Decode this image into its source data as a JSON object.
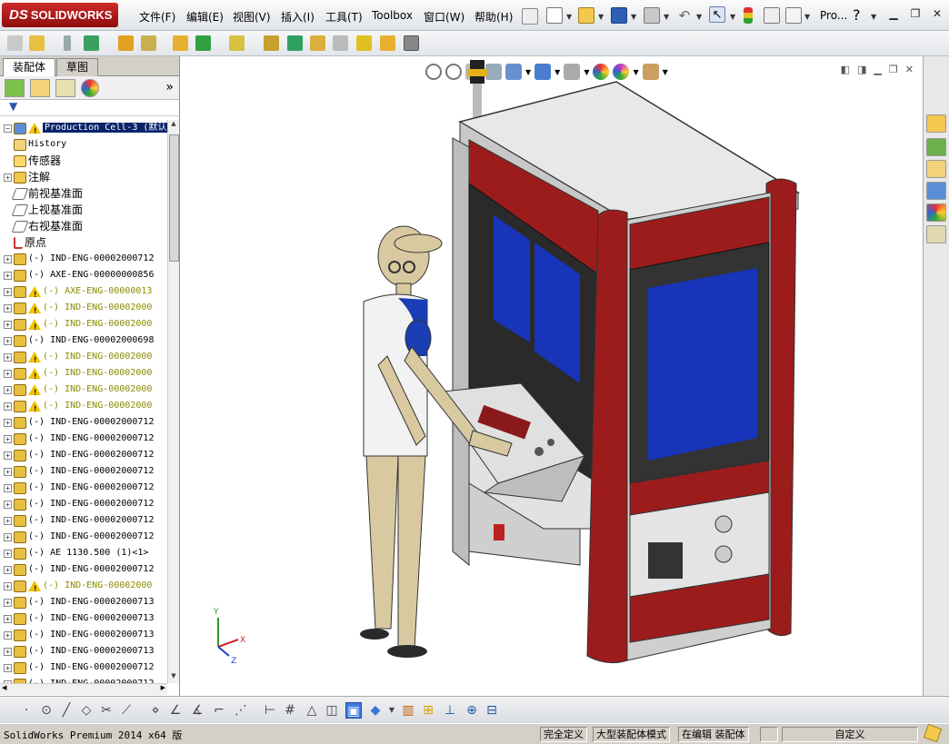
{
  "app": {
    "logo_text": "SOLIDWORKS",
    "logo_mark": "DS"
  },
  "menu": [
    {
      "label": "文件(F)"
    },
    {
      "label": "编辑(E)"
    },
    {
      "label": "视图(V)"
    },
    {
      "label": "插入(I)"
    },
    {
      "label": "工具(T)"
    },
    {
      "label": "Toolbox"
    },
    {
      "label": "窗口(W)"
    },
    {
      "label": "帮助(H)"
    }
  ],
  "title_search": "Pro...",
  "help_glyph": "?",
  "sidebar": {
    "tabs": [
      {
        "label": "装配体"
      },
      {
        "label": "草图"
      }
    ],
    "expand_glyph": "»",
    "tree": [
      {
        "label": "Production Cell-3  (默认",
        "kind": "root",
        "exp": "−",
        "selected": true,
        "warn": true
      },
      {
        "label": "History",
        "kind": "history",
        "exp": ""
      },
      {
        "label": "传感器",
        "kind": "sensor",
        "exp": "",
        "cjk": true
      },
      {
        "label": "注解",
        "kind": "annot",
        "exp": "+",
        "cjk": true
      },
      {
        "label": "前视基准面",
        "kind": "plane",
        "exp": "",
        "cjk": true
      },
      {
        "label": "上视基准面",
        "kind": "plane",
        "exp": "",
        "cjk": true
      },
      {
        "label": "右视基准面",
        "kind": "plane",
        "exp": "",
        "cjk": true
      },
      {
        "label": "原点",
        "kind": "origin",
        "exp": "",
        "cjk": true
      },
      {
        "label": "(-) IND-ENG-00002000712",
        "kind": "part",
        "exp": "+"
      },
      {
        "label": "(-) AXE-ENG-00000000856",
        "kind": "part",
        "exp": "+"
      },
      {
        "label": "(-) AXE-ENG-00000013",
        "kind": "part",
        "exp": "+",
        "warn": true,
        "dim": true
      },
      {
        "label": "(-) IND-ENG-00002000",
        "kind": "part",
        "exp": "+",
        "warn": true,
        "dim": true
      },
      {
        "label": "(-) IND-ENG-00002000",
        "kind": "part",
        "exp": "+",
        "warn": true,
        "dim": true
      },
      {
        "label": "(-) IND-ENG-00002000698",
        "kind": "part",
        "exp": "+"
      },
      {
        "label": "(-) IND-ENG-00002000",
        "kind": "part",
        "exp": "+",
        "warn": true,
        "dim": true
      },
      {
        "label": "(-) IND-ENG-00002000",
        "kind": "part",
        "exp": "+",
        "warn": true,
        "dim": true
      },
      {
        "label": "(-) IND-ENG-00002000",
        "kind": "part",
        "exp": "+",
        "warn": true,
        "dim": true
      },
      {
        "label": "(-) IND-ENG-00002000",
        "kind": "part",
        "exp": "+",
        "warn": true,
        "dim": true
      },
      {
        "label": "(-) IND-ENG-00002000712",
        "kind": "part",
        "exp": "+"
      },
      {
        "label": "(-) IND-ENG-00002000712",
        "kind": "part",
        "exp": "+"
      },
      {
        "label": "(-) IND-ENG-00002000712",
        "kind": "part",
        "exp": "+"
      },
      {
        "label": "(-) IND-ENG-00002000712",
        "kind": "part",
        "exp": "+"
      },
      {
        "label": "(-) IND-ENG-00002000712",
        "kind": "part",
        "exp": "+"
      },
      {
        "label": "(-) IND-ENG-00002000712",
        "kind": "part",
        "exp": "+"
      },
      {
        "label": "(-) IND-ENG-00002000712",
        "kind": "part",
        "exp": "+"
      },
      {
        "label": "(-) IND-ENG-00002000712",
        "kind": "part",
        "exp": "+"
      },
      {
        "label": "(-) AE 1130.500 (1)<1>",
        "kind": "part",
        "exp": "+"
      },
      {
        "label": "(-) IND-ENG-00002000712",
        "kind": "part",
        "exp": "+"
      },
      {
        "label": "(-) IND-ENG-00002000",
        "kind": "part",
        "exp": "+",
        "warn": true,
        "dim": true
      },
      {
        "label": "(-) IND-ENG-00002000713",
        "kind": "part",
        "exp": "+"
      },
      {
        "label": "(-) IND-ENG-00002000713",
        "kind": "part",
        "exp": "+"
      },
      {
        "label": "(-) IND-ENG-00002000713",
        "kind": "part",
        "exp": "+"
      },
      {
        "label": "(-) IND-ENG-00002000713",
        "kind": "part",
        "exp": "+"
      },
      {
        "label": "(-) IND-ENG-00002000712",
        "kind": "part",
        "exp": "+"
      },
      {
        "label": "(-) IND-ENG-00002000712",
        "kind": "part",
        "exp": "+"
      }
    ]
  },
  "viewport": {
    "triad": {
      "x": "X",
      "y": "Y",
      "z": "Z"
    }
  },
  "status": {
    "product": "SolidWorks Premium 2014 x64 版",
    "cells": [
      {
        "label": "完全定义"
      },
      {
        "label": "大型装配体模式"
      },
      {
        "label": "在编辑 装配体"
      },
      {
        "label": "自定义"
      }
    ]
  },
  "colors": {
    "cabinet_red": "#9c1c1c",
    "window_blue": "#1834b8",
    "selection": "#0a246a",
    "warning": "#f2c200",
    "part_icon": "#e8c040"
  }
}
